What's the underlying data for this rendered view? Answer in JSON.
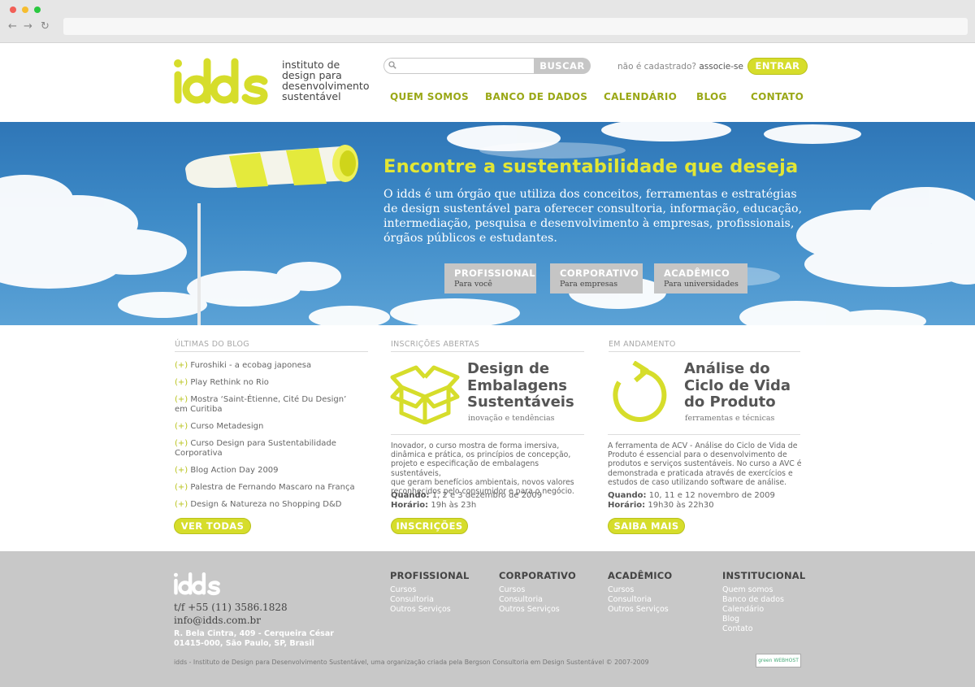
{
  "header": {
    "logo_text": "idds",
    "logo_lines": [
      "instituto de",
      "design para",
      "desenvolvimento",
      "sustentável"
    ],
    "search": {
      "placeholder": "",
      "button_label": "BUSCAR"
    },
    "register_prompt": "não é cadastrado?",
    "register_link": "associe-se",
    "login_label": "ENTRAR",
    "nav": [
      "QUEM SOMOS",
      "BANCO DE DADOS",
      "CALENDÁRIO",
      "BLOG",
      "CONTATO"
    ]
  },
  "hero": {
    "title": "Encontre a sustentabilidade que deseja",
    "text_lines": [
      "O idds é um órgão que utiliza dos conceitos, ferramentas e estratégias",
      "de design sustentável para oferecer consultoria, informação, educação,",
      "intermediação, pesquisa e desenvolvimento à empresas, profissionais,",
      "órgãos públicos e estudantes."
    ],
    "buttons": [
      {
        "title": "PROFISSIONAL",
        "subtitle": "Para você"
      },
      {
        "title": "CORPORATIVO",
        "subtitle": "Para empresas"
      },
      {
        "title": "ACADÊMICO",
        "subtitle": "Para universidades"
      }
    ]
  },
  "blog": {
    "heading": "ÚLTIMAS DO BLOG",
    "bullet": "(+)",
    "items": [
      [
        "Furoshiki - a ecobag japonesa"
      ],
      [
        "Play Rethink no Rio"
      ],
      [
        "Mostra ‘Saint-Étienne, Cité Du Design’",
        "em Curitiba"
      ],
      [
        "Curso Metadesign"
      ],
      [
        "Curso Design para Sustentabilidade",
        "Corporativa"
      ],
      [
        "Blog Action Day 2009"
      ],
      [
        "Palestra de Fernando Mascaro na França"
      ],
      [
        "Design & Natureza no Shopping D&D"
      ]
    ],
    "button_label": "VER TODAS"
  },
  "course1": {
    "heading": "INSCRIÇÕES ABERTAS",
    "icon": "open-box-icon",
    "title_lines": [
      "Design de",
      "Embalagens",
      "Sustentáveis"
    ],
    "subtitle": "inovação e tendências",
    "desc_lines": [
      "Inovador, o curso mostra de forma imersiva,",
      "dinâmica e prática, os princípios de concepção,",
      "projeto e especificação de embalagens sustentáveis,",
      "que geram benefícios ambientais, novos valores",
      "reconhecidos pelo consumidor e para o negócio."
    ],
    "when_label": "Quando:",
    "when_value": "1, 2 e 3 dezembro de 2009",
    "time_label": "Horário:",
    "time_value": "19h às 23h",
    "button_label": "INSCRIÇÕES"
  },
  "course2": {
    "heading": "EM ANDAMENTO",
    "icon": "cycle-arrow-icon",
    "title_lines": [
      "Análise do",
      "Ciclo de Vida",
      "do Produto"
    ],
    "subtitle": "ferramentas e técnicas",
    "desc_lines": [
      "A ferramenta de ACV - Análise do Ciclo de Vida de",
      "Produto é essencial para o desenvolvimento de",
      "produtos e serviços sustentáveis. No curso a AVC é",
      "demonstrada e praticada através de exercícios e",
      "estudos de caso utilizando software de análise."
    ],
    "when_label": "Quando:",
    "when_value": "10, 11 e 12 novembro de 2009",
    "time_label": "Horário:",
    "time_value": "19h30 às 22h30",
    "button_label": "SAIBA MAIS"
  },
  "footer": {
    "logo_text": "idds",
    "phone": "t/f +55 (11) 3586.1828",
    "email": "info@idds.com.br",
    "address_lines": [
      "R. Bela Cintra, 409 - Cerqueira César",
      "01415-000, São Paulo, SP, Brasil"
    ],
    "columns": [
      {
        "heading": "PROFISSIONAL",
        "links": [
          "Cursos",
          "Consultoria",
          "Outros Serviços"
        ]
      },
      {
        "heading": "CORPORATIVO",
        "links": [
          "Cursos",
          "Consultoria",
          "Outros Serviços"
        ]
      },
      {
        "heading": "ACADÊMICO",
        "links": [
          "Cursos",
          "Consultoria",
          "Outros Serviços"
        ]
      },
      {
        "heading": "INSTITUCIONAL",
        "links": [
          "Quem somos",
          "Banco de dados",
          "Calendário",
          "Blog",
          "Contato"
        ]
      }
    ],
    "copyright": "idds - Instituto de Design para Desenvolvimento Sustentável, uma organização criada pela Bergson Consultoria em Design Sustentável © 2007-2009",
    "badge_text": "green WEBHOST"
  },
  "colors": {
    "accent": "#d6dd2b",
    "accent_dark": "#9aa817",
    "footer_bg": "#c8c8c8",
    "sky": "#3d8ac7"
  }
}
